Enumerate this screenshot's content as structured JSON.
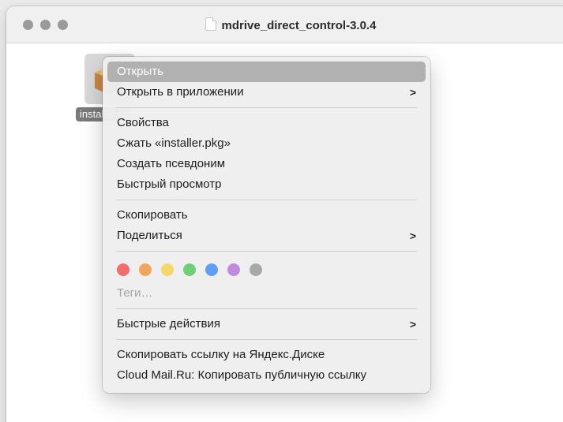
{
  "window": {
    "title": "mdrive_direct_control-3.0.4"
  },
  "file": {
    "label": "installer.pkg",
    "icon": "package-icon"
  },
  "context_menu": {
    "open": "Открыть",
    "open_with": "Открыть в приложении",
    "properties": "Свойства",
    "compress": "Сжать «installer.pkg»",
    "make_alias": "Создать псевдоним",
    "quick_look": "Быстрый просмотр",
    "copy": "Скопировать",
    "share": "Поделиться",
    "tags": "Теги…",
    "quick_actions": "Быстрые действия",
    "copy_yandex_link": "Скопировать ссылку на Яндекс.Диске",
    "cloud_mail_link": "Cloud Mail.Ru: Копировать публичную ссылку",
    "submenu_glyph": ">"
  },
  "tag_colors": [
    {
      "name": "red",
      "color": "#f46c6c"
    },
    {
      "name": "orange",
      "color": "#f5a45e"
    },
    {
      "name": "yellow",
      "color": "#f5d867"
    },
    {
      "name": "green",
      "color": "#6fcf75"
    },
    {
      "name": "blue",
      "color": "#5f9ef7"
    },
    {
      "name": "purple",
      "color": "#c38be0"
    },
    {
      "name": "gray",
      "color": "#a8a8a8"
    }
  ],
  "colors": {
    "highlight": "#b1b1b1",
    "menu_background": "#eeeeee"
  }
}
